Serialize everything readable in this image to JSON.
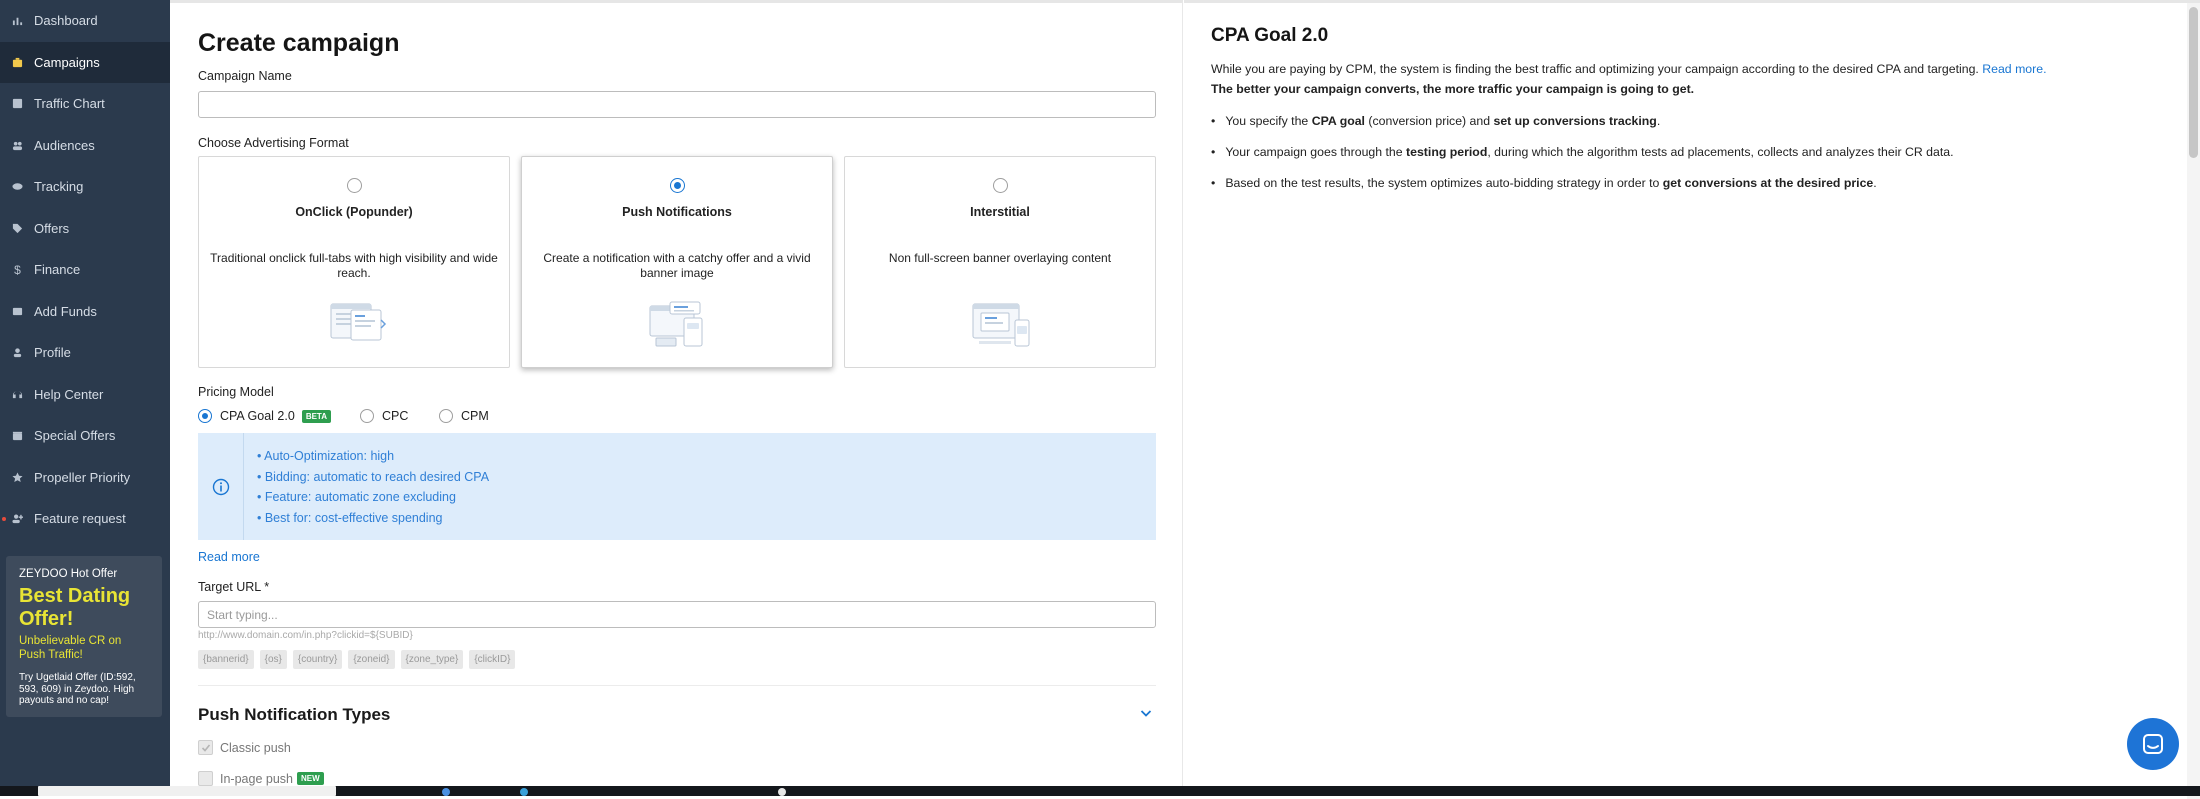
{
  "sidebar": {
    "items": [
      {
        "label": "Dashboard",
        "icon": "bar-chart-icon",
        "active": false
      },
      {
        "label": "Campaigns",
        "icon": "briefcase-icon",
        "active": true
      },
      {
        "label": "Traffic Chart",
        "icon": "traffic-chart-icon",
        "active": false
      },
      {
        "label": "Audiences",
        "icon": "people-icon",
        "active": false
      },
      {
        "label": "Tracking",
        "icon": "eye-icon",
        "active": false
      },
      {
        "label": "Offers",
        "icon": "tag-icon",
        "active": false
      },
      {
        "label": "Finance",
        "icon": "dollar-icon",
        "active": false
      },
      {
        "label": "Add Funds",
        "icon": "card-icon",
        "active": false
      },
      {
        "label": "Profile",
        "icon": "person-icon",
        "active": false
      },
      {
        "label": "Help Center",
        "icon": "headset-icon",
        "active": false
      },
      {
        "label": "Special Offers",
        "icon": "gift-icon",
        "active": false
      },
      {
        "label": "Propeller Priority",
        "icon": "star-icon",
        "active": false
      },
      {
        "label": "Feature request",
        "icon": "person-add-icon",
        "active": false
      }
    ],
    "promo": {
      "header": "ZEYDOO Hot Offer",
      "title": "Best Dating Offer!",
      "subtitle": "Unbelievable CR on Push Traffic!",
      "body": "Try Ugetlaid Offer (ID:592, 593, 609) in Zeydoo. High payouts and no cap!"
    }
  },
  "main": {
    "title": "Create campaign",
    "campaign_name_label": "Campaign Name",
    "campaign_name_value": "",
    "format_label": "Choose Advertising Format",
    "formats": [
      {
        "title": "OnClick (Popunder)",
        "desc": "Traditional onclick full-tabs with high visibility and wide reach.",
        "selected": false
      },
      {
        "title": "Push Notifications",
        "desc": "Create a notification with a catchy offer and a vivid banner image",
        "selected": true
      },
      {
        "title": "Interstitial",
        "desc": "Non full-screen banner overlaying content",
        "selected": false
      }
    ],
    "pricing_label": "Pricing Model",
    "pricing_options": [
      {
        "label": "CPA Goal 2.0",
        "badge": "BETA",
        "selected": true
      },
      {
        "label": "CPC",
        "selected": false
      },
      {
        "label": "CPM",
        "selected": false
      }
    ],
    "info_items": [
      "• Auto-Optimization: high",
      "• Bidding: automatic to reach desired CPA",
      "• Feature: automatic zone excluding",
      "• Best for: cost-effective spending"
    ],
    "read_more": "Read more",
    "target_url_label": "Target URL *",
    "target_url_placeholder": "Start typing...",
    "target_url_hint": "http://www.domain.com/in.php?clickid=${SUBID}",
    "macros": [
      "{bannerid}",
      "{os}",
      "{country}",
      "{zoneid}",
      "{zone_type}",
      "{clickID}"
    ],
    "push_types_title": "Push Notification Types",
    "push_types": [
      {
        "label": "Classic push",
        "badge": ""
      },
      {
        "label": "In-page push",
        "badge": "NEW"
      }
    ]
  },
  "right_panel": {
    "title": "CPA Goal 2.0",
    "intro": "While you are paying by CPM, the system is finding the best traffic and optimizing your campaign according to the desired CPA and targeting.",
    "intro_link": "Read more.",
    "bold_line": "The better your campaign converts, the more traffic your campaign is going to get.",
    "bullets": {
      "b1_a": "You specify the ",
      "b1_b": "CPA goal",
      "b1_c": " (conversion price) and ",
      "b1_d": "set up conversions tracking",
      "b1_e": ".",
      "b2_a": "Your campaign goes through the ",
      "b2_b": "testing period",
      "b2_c": ", during which the algorithm tests ad placements, collects and analyzes their CR data.",
      "b3_a": "Based on the test results, the system optimizes auto-bidding strategy in order to ",
      "b3_b": "get conversions at the desired price",
      "b3_c": "."
    }
  },
  "colors": {
    "sidebar_bg": "#2b3a4d",
    "accent_blue": "#1976d2",
    "info_bg": "#ddecfb",
    "promo_yellow": "#e8e435",
    "badge_green": "#2e9e4f",
    "chat_button": "#1e74d6"
  }
}
